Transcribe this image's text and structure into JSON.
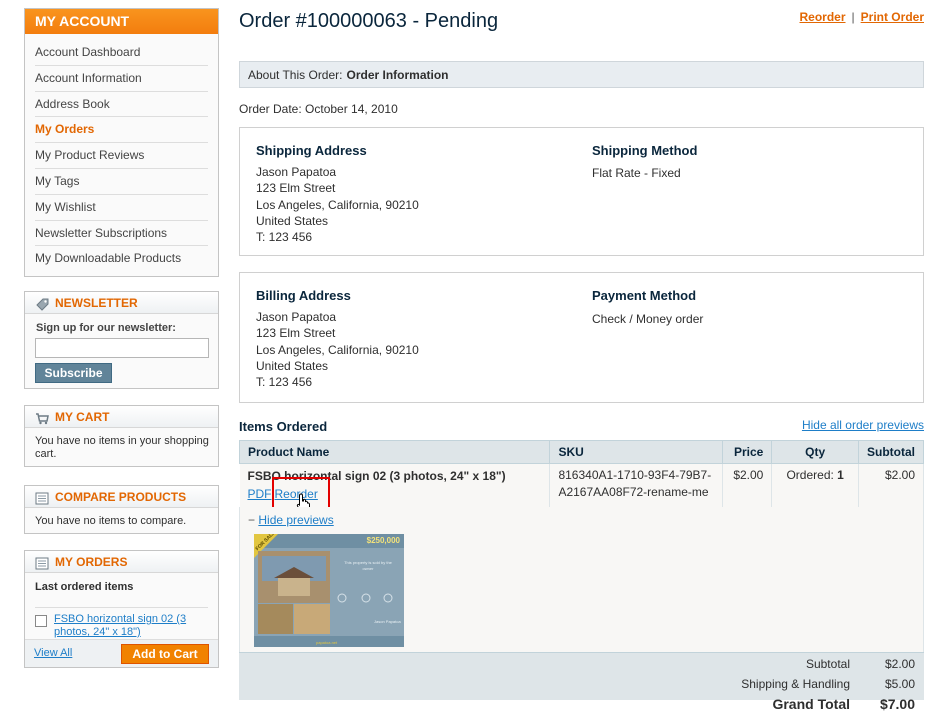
{
  "sidebar": {
    "account_title": "MY ACCOUNT",
    "account_items": [
      "Account Dashboard",
      "Account Information",
      "Address Book",
      "My Orders",
      "My Product Reviews",
      "My Tags",
      "My Wishlist",
      "Newsletter Subscriptions",
      "My Downloadable Products"
    ],
    "active_item": "My Orders",
    "newsletter": {
      "title": "NEWSLETTER",
      "label": "Sign up for our newsletter:",
      "input_value": "",
      "button": "Subscribe"
    },
    "cart": {
      "title": "MY CART",
      "text": "You have no items in your shopping cart."
    },
    "compare": {
      "title": "COMPARE PRODUCTS",
      "text": "You have no items to compare."
    },
    "orders": {
      "title": "MY ORDERS",
      "subtitle": "Last ordered items",
      "item_link": "FSBO horizontal sign 02 (3 photos, 24\" x 18\")",
      "view_all": "View All",
      "add_to_cart": "Add to Cart"
    }
  },
  "main": {
    "title": "Order #100000063 - Pending",
    "reorder": "Reorder",
    "separator": "|",
    "print_order": "Print Order",
    "about_label": "About This Order:",
    "about_value": "Order Information",
    "order_date": "Order Date: October 14, 2010",
    "shipping_address": {
      "title": "Shipping Address",
      "lines": [
        "Jason Papatoa",
        "123 Elm Street",
        "Los Angeles, California, 90210",
        "United States",
        "T: 123 456"
      ]
    },
    "shipping_method": {
      "title": "Shipping Method",
      "value": "Flat Rate - Fixed"
    },
    "billing_address": {
      "title": "Billing Address",
      "lines": [
        "Jason Papatoa",
        "123 Elm Street",
        "Los Angeles, California, 90210",
        "United States",
        "T: 123 456"
      ]
    },
    "payment_method": {
      "title": "Payment Method",
      "value": "Check / Money order"
    },
    "items_title": "Items Ordered",
    "hide_all": "Hide all order previews",
    "columns": [
      "Product Name",
      "SKU",
      "Price",
      "Qty",
      "Subtotal"
    ],
    "item": {
      "name": "FSBO horizontal sign 02 (3 photos, 24\" x 18\")",
      "pdf": "PDF",
      "reorder": "Reorder",
      "sku_line1": "816340A1-1710-93F4-79B7-",
      "sku_line2": "A2167AA08F72-rename-me",
      "price": "$2.00",
      "qty_label": "Ordered:",
      "qty": "1",
      "subtotal": "$2.00"
    },
    "hide_previews_prefix": "−",
    "hide_previews": "Hide previews",
    "preview": {
      "badge": "FOR SALE",
      "price": "$250,000",
      "blurb1": "This property is sold by the",
      "blurb2": "owner",
      "contact": "Jason Papatoa",
      "website": "papatoa.net"
    },
    "totals": [
      {
        "label": "Subtotal",
        "value": "$2.00"
      },
      {
        "label": "Shipping & Handling",
        "value": "$5.00"
      },
      {
        "label": "Grand Total",
        "value": "$7.00"
      }
    ]
  }
}
